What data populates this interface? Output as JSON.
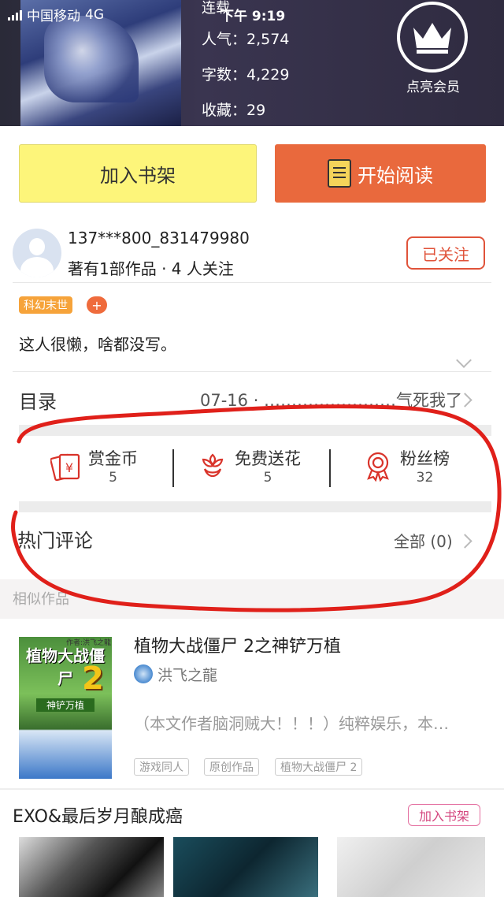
{
  "status_bar": {
    "carrier": "中国移动",
    "network": "4G",
    "time": "下午 9:19"
  },
  "book": {
    "status": "连载",
    "popularity_label": "人气：",
    "popularity": "2,574",
    "word_count_label": "字数：",
    "word_count": "4,229",
    "favorites_label": "收藏：",
    "favorites": "29"
  },
  "vip": {
    "label": "点亮会员"
  },
  "buttons": {
    "add_shelf": "加入书架",
    "start_read": "开始阅读"
  },
  "author": {
    "name": "137***800_831479980",
    "meta": "著有1部作品 · 4 人关注",
    "follow_label": "已关注",
    "genre_tag": "科幻末世",
    "add_tag": "+",
    "bio": "这人很懒，啥都没写。"
  },
  "toc": {
    "label": "目录",
    "latest": "07-16 · ……………………气死我了"
  },
  "actions": [
    {
      "label": "赏金币",
      "count": "5",
      "color": "#d9332a"
    },
    {
      "label": "免费送花",
      "count": "5",
      "color": "#d9332a"
    },
    {
      "label": "粉丝榜",
      "count": "32",
      "color": "#d9332a"
    }
  ],
  "comments": {
    "label": "热门评论",
    "all": "全部 (0)"
  },
  "similar": {
    "label": "相似作品",
    "book": {
      "title": "植物大战僵尸 2之神铲万植",
      "author": "洪飞之龍",
      "desc": "（本文作者脑洞贼大！！！）纯粹娱乐，本…",
      "tags": [
        "游戏同人",
        "原创作品",
        "植物大战僵尸 2"
      ],
      "cover_title": "植物大战僵尸",
      "cover_num": "2",
      "cover_sub": "神铲万植",
      "cover_author": "作者:洪飞之龍"
    }
  },
  "list": {
    "title": "EXO&最后岁月酿成癌",
    "add_label": "加入书架"
  },
  "annotation_color": "#e0201a"
}
